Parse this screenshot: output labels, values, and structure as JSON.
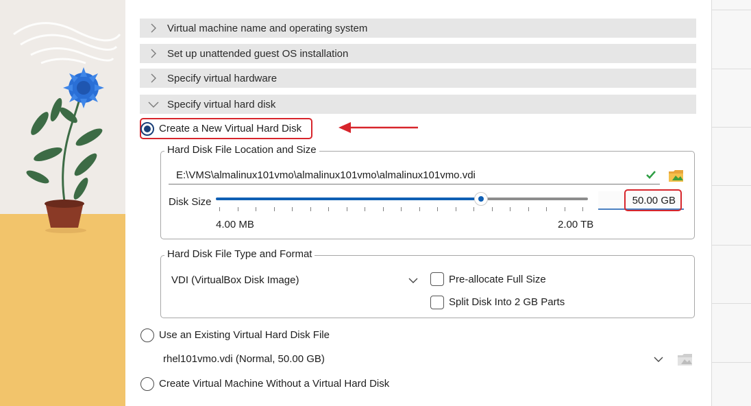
{
  "sections": [
    {
      "label": "Virtual machine name and operating system",
      "expanded": false
    },
    {
      "label": "Set up unattended guest OS installation",
      "expanded": false
    },
    {
      "label": "Specify virtual hardware",
      "expanded": false
    },
    {
      "label": "Specify virtual hard disk",
      "expanded": true
    }
  ],
  "disk_options": {
    "create_new": {
      "label": "Create a New Virtual Hard Disk",
      "selected": true
    },
    "use_existing": {
      "label": "Use an Existing Virtual Hard Disk File",
      "selected": false,
      "selected_file": "rhel101vmo.vdi (Normal, 50.00 GB)"
    },
    "no_disk": {
      "label": "Create Virtual Machine Without a Virtual Hard Disk",
      "selected": false
    }
  },
  "location_group": {
    "title": "Hard Disk File Location and Size",
    "file_path": "E:\\VMS\\almalinux101vmo\\almalinux101vmo\\almalinux101vmo.vdi",
    "size_label": "Disk Size",
    "size_value": "50.00 GB",
    "slider_min_label": "4.00 MB",
    "slider_max_label": "2.00 TB",
    "slider_fraction": 0.71
  },
  "format_group": {
    "title": "Hard Disk File Type and Format",
    "type_selected": "VDI (VirtualBox Disk Image)",
    "preallocate_label": "Pre-allocate Full Size",
    "preallocate_checked": false,
    "split_label": "Split Disk Into 2 GB Parts",
    "split_checked": false
  },
  "colors": {
    "accent": "#0f5fb4",
    "annotation": "#d7252b",
    "section_bg": "#e6e6e6",
    "valid_check": "#2e9e44",
    "folder": "#e8a53a"
  },
  "icons": [
    "chevron-right-icon",
    "chevron-down-icon",
    "check-mark-icon",
    "folder-icon",
    "dropdown-arrow-icon"
  ]
}
